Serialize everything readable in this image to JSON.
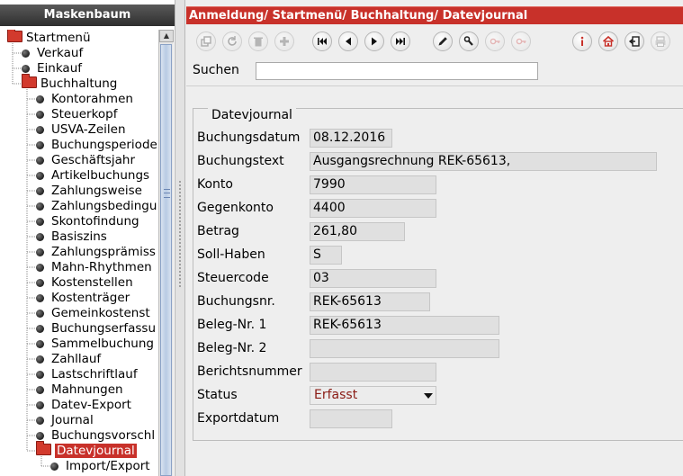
{
  "left_panel": {
    "title": "Maskenbaum",
    "tree": [
      {
        "label": "Startmenü",
        "kind": "folder",
        "level": 0
      },
      {
        "label": "Verkauf",
        "kind": "leaf",
        "level": 1
      },
      {
        "label": "Einkauf",
        "kind": "leaf",
        "level": 1
      },
      {
        "label": "Buchhaltung",
        "kind": "folder",
        "level": 1
      },
      {
        "label": "Kontorahmen",
        "kind": "leaf",
        "level": 2
      },
      {
        "label": "Steuerkopf",
        "kind": "leaf",
        "level": 2
      },
      {
        "label": "USVA-Zeilen",
        "kind": "leaf",
        "level": 2
      },
      {
        "label": "Buchungsperiode",
        "kind": "leaf",
        "level": 2
      },
      {
        "label": "Geschäftsjahr",
        "kind": "leaf",
        "level": 2
      },
      {
        "label": "Artikelbuchungs",
        "kind": "leaf",
        "level": 2
      },
      {
        "label": "Zahlungsweise",
        "kind": "leaf",
        "level": 2
      },
      {
        "label": "Zahlungsbedingu",
        "kind": "leaf",
        "level": 2
      },
      {
        "label": "Skontofindung",
        "kind": "leaf",
        "level": 2
      },
      {
        "label": "Basiszins",
        "kind": "leaf",
        "level": 2
      },
      {
        "label": "Zahlungsprämiss",
        "kind": "leaf",
        "level": 2
      },
      {
        "label": "Mahn-Rhythmen",
        "kind": "leaf",
        "level": 2
      },
      {
        "label": "Kostenstellen",
        "kind": "leaf",
        "level": 2
      },
      {
        "label": "Kostenträger",
        "kind": "leaf",
        "level": 2
      },
      {
        "label": "Gemeinkostenst",
        "kind": "leaf",
        "level": 2
      },
      {
        "label": "Buchungserfassu",
        "kind": "leaf",
        "level": 2
      },
      {
        "label": "Sammelbuchung",
        "kind": "leaf",
        "level": 2
      },
      {
        "label": "Zahllauf",
        "kind": "leaf",
        "level": 2
      },
      {
        "label": "Lastschriftlauf",
        "kind": "leaf",
        "level": 2
      },
      {
        "label": "Mahnungen",
        "kind": "leaf",
        "level": 2
      },
      {
        "label": "Datev-Export",
        "kind": "leaf",
        "level": 2
      },
      {
        "label": "Journal",
        "kind": "leaf",
        "level": 2
      },
      {
        "label": "Buchungsvorschl",
        "kind": "leaf",
        "level": 2
      },
      {
        "label": "Datevjournal",
        "kind": "folder",
        "level": 2,
        "selected": true
      },
      {
        "label": "Import/Export",
        "kind": "leaf",
        "level": 3
      }
    ]
  },
  "header": {
    "breadcrumb": "Anmeldung/ Startmenü/ Buchhaltung/ Datevjournal"
  },
  "toolbar": {
    "buttons": [
      {
        "name": "copy-record",
        "icon": "copy-icon",
        "enabled": false
      },
      {
        "name": "refresh",
        "icon": "refresh-icon",
        "enabled": false
      },
      {
        "name": "delete",
        "icon": "trash-icon",
        "enabled": false
      },
      {
        "name": "new",
        "icon": "plus-icon",
        "enabled": false
      },
      {
        "name": "first",
        "icon": "first-icon",
        "enabled": true
      },
      {
        "name": "previous",
        "icon": "previous-icon",
        "enabled": true
      },
      {
        "name": "next",
        "icon": "next-icon",
        "enabled": true
      },
      {
        "name": "last",
        "icon": "last-icon",
        "enabled": true
      },
      {
        "name": "edit",
        "icon": "pencil-icon",
        "enabled": true
      },
      {
        "name": "tools",
        "icon": "wrench-icon",
        "enabled": true
      },
      {
        "name": "search-record",
        "icon": "key-search-icon",
        "enabled": false
      },
      {
        "name": "search-record-2",
        "icon": "key-search-icon",
        "enabled": false
      },
      {
        "name": "info",
        "icon": "info-icon",
        "enabled": true
      },
      {
        "name": "home",
        "icon": "home-icon",
        "enabled": true
      },
      {
        "name": "exit",
        "icon": "exit-icon",
        "enabled": true
      },
      {
        "name": "print",
        "icon": "print-icon",
        "enabled": false
      }
    ]
  },
  "search": {
    "label": "Suchen",
    "value": ""
  },
  "form": {
    "group_title": "Datevjournal",
    "fields": {
      "buchungsdatum": {
        "label": "Buchungsdatum",
        "value": "08.12.2016"
      },
      "buchungstext": {
        "label": "Buchungstext",
        "value": "Ausgangsrechnung REK-65613,"
      },
      "konto": {
        "label": "Konto",
        "value": "7990"
      },
      "gegenkonto": {
        "label": "Gegenkonto",
        "value": "4400"
      },
      "betrag": {
        "label": "Betrag",
        "value": "261,80"
      },
      "soll_haben": {
        "label": "Soll-Haben",
        "value": "S"
      },
      "steuercode": {
        "label": "Steuercode",
        "value": "03"
      },
      "buchungsnr": {
        "label": "Buchungsnr.",
        "value": "REK-65613"
      },
      "beleg_nr_1": {
        "label": "Beleg-Nr. 1",
        "value": "REK-65613"
      },
      "beleg_nr_2": {
        "label": "Beleg-Nr. 2",
        "value": ""
      },
      "berichtsnummer": {
        "label": "Berichtsnummer",
        "value": ""
      },
      "status": {
        "label": "Status",
        "value": "Erfasst"
      },
      "exportdatum": {
        "label": "Exportdatum",
        "value": ""
      }
    }
  },
  "colors": {
    "accent": "#c8312a",
    "status_text": "#8a1b14"
  }
}
